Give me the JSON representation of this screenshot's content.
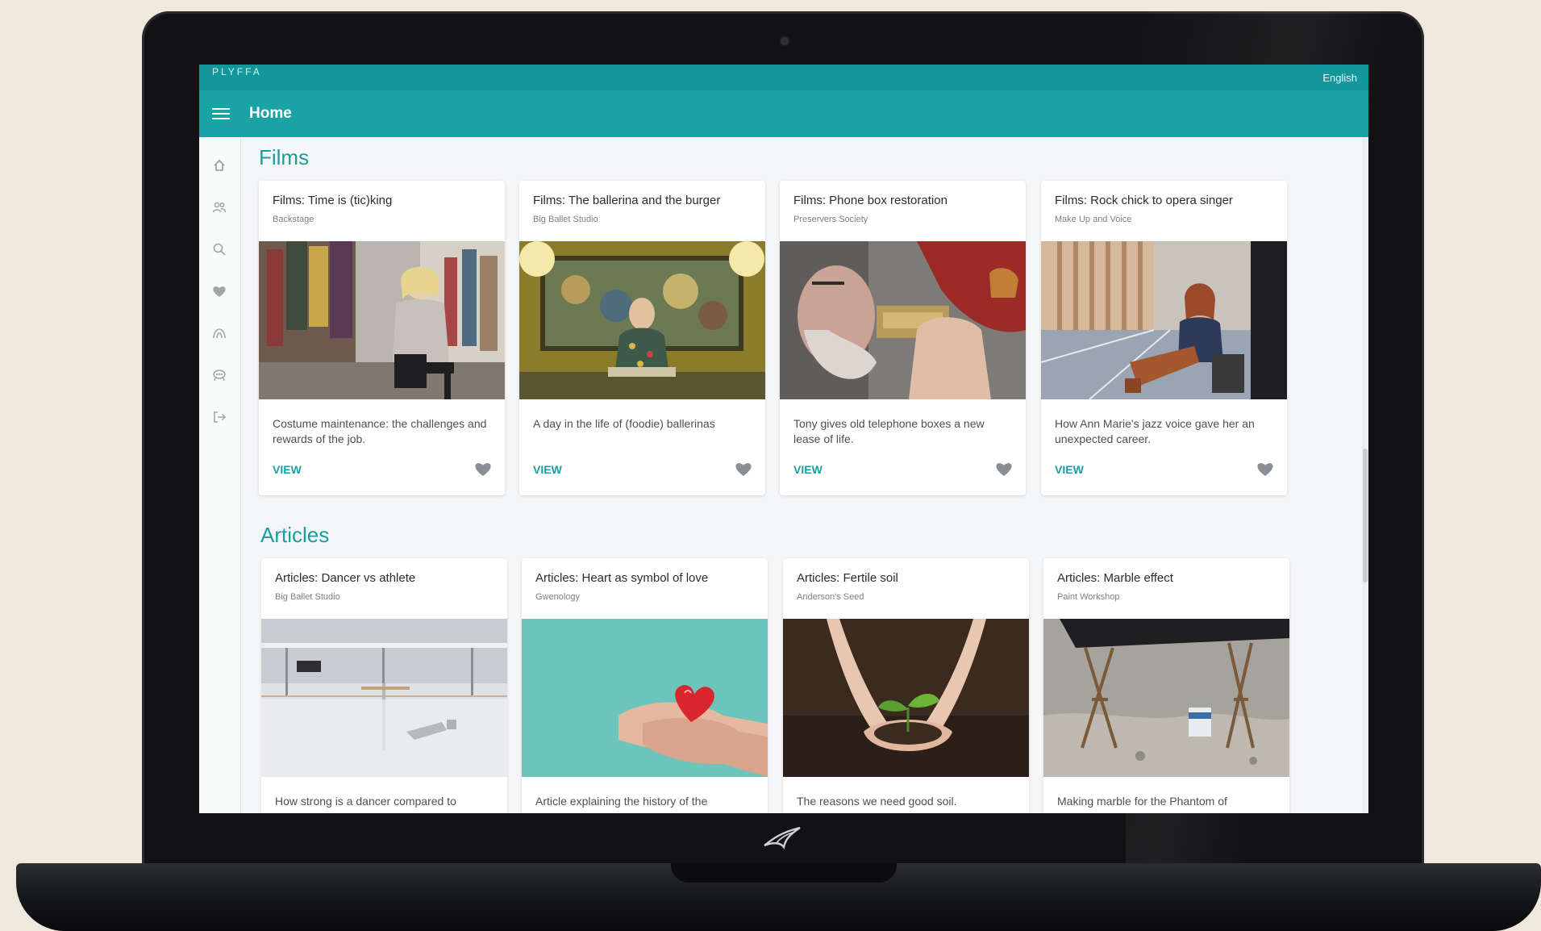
{
  "status_bar": {
    "brand": "PLYFFA",
    "language": "English"
  },
  "app_bar": {
    "title": "Home"
  },
  "side_rail": {
    "icons": [
      "home-icon",
      "people-icon",
      "search-icon",
      "heart-icon",
      "tent-icon",
      "badge-icon",
      "logout-icon"
    ]
  },
  "sections": [
    {
      "title": "Films",
      "cards": [
        {
          "title": "Films: Time is (tic)king",
          "subtitle": "Backstage",
          "description": "Costume maintenance: the challenges and rewards of the job.",
          "action": "VIEW"
        },
        {
          "title": "Films: The ballerina and the burger",
          "subtitle": "Big Ballet Studio",
          "description": "A day in the life of (foodie) ballerinas",
          "action": "VIEW"
        },
        {
          "title": "Films: Phone box restoration",
          "subtitle": "Preservers Society",
          "description": "Tony gives old telephone boxes a new lease of life.",
          "action": "VIEW"
        },
        {
          "title": "Films: Rock chick to opera singer",
          "subtitle": "Make Up and Voice",
          "description": "How Ann Marie's jazz voice gave her an unexpected career.",
          "action": "VIEW"
        }
      ]
    },
    {
      "title": "Articles",
      "cards": [
        {
          "title": "Articles: Dancer vs athlete",
          "subtitle": "Big Ballet Studio",
          "description": "How strong is a dancer compared to"
        },
        {
          "title": "Articles: Heart as symbol of love",
          "subtitle": "Gwenology",
          "description": "Article explaining the history of the"
        },
        {
          "title": "Articles: Fertile soil",
          "subtitle": "Anderson's Seed",
          "description": "The reasons we need good soil."
        },
        {
          "title": "Articles: Marble effect",
          "subtitle": "Paint Workshop",
          "description": "Making marble for the Phantom of"
        }
      ]
    }
  ],
  "colors": {
    "status_bar": "#12979a",
    "app_bar": "#1aa3a5",
    "accent": "#1a9ea1",
    "background": "#f5f6f7"
  }
}
